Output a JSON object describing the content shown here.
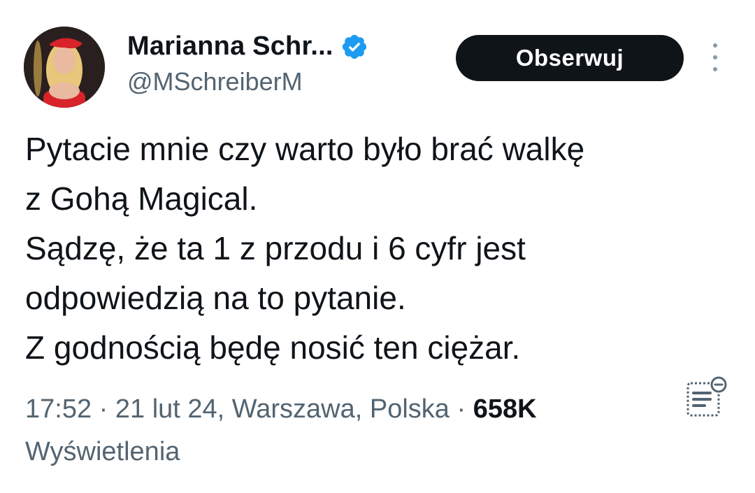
{
  "author": {
    "display_name": "Marianna Schr...",
    "handle": "@MSchreiberM",
    "avatar_icon": "profile-photo",
    "verified_icon": "verified-badge-icon",
    "verified_color": "#1d9bf0"
  },
  "actions": {
    "follow_label": "Obserwuj",
    "more_icon": "more-vertical-icon",
    "notes_icon": "community-notes-icon"
  },
  "tweet": {
    "lines": [
      "Pytacie mnie czy warto było brać walkę",
      "z Gohą Magical.",
      "Sądzę, że ta 1 z przodu i 6 cyfr jest",
      "odpowiedzią na to pytanie.",
      "Z godnością będę nosić ten ciężar."
    ]
  },
  "meta": {
    "time": "17:52",
    "date": "21 lut 24",
    "location": "Warszawa, Polska",
    "separator": "·",
    "views_count": "658K",
    "views_label": "Wyświetlenia"
  },
  "colors": {
    "text_primary": "#0f1419",
    "text_secondary": "#536471",
    "button_bg": "#0f1419",
    "button_text": "#ffffff"
  }
}
